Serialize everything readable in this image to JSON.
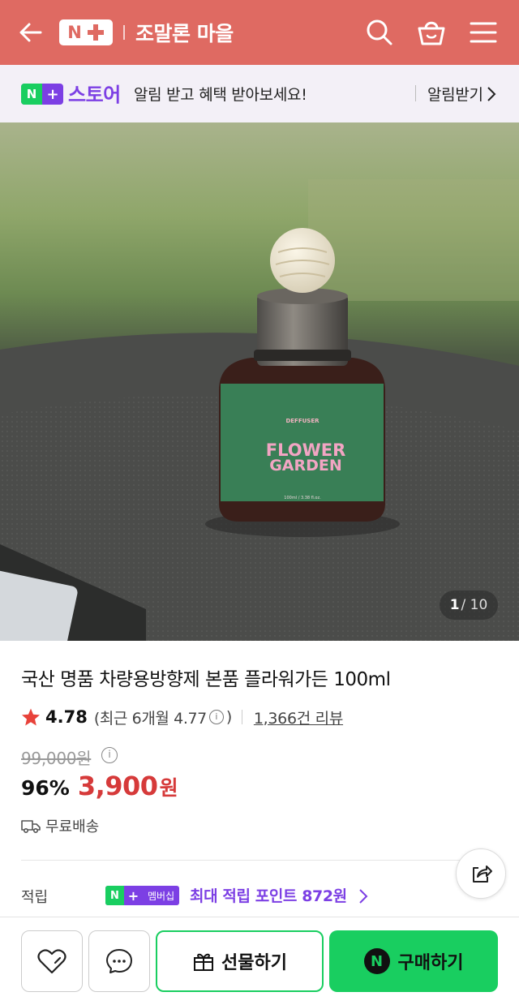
{
  "header": {
    "logo_text": "N",
    "store_name": "조말론 마을",
    "bg_color": "#df6a62"
  },
  "promo": {
    "badge_n": "N",
    "store_word": "스토어",
    "message": "알림 받고 혜택 받아보세요!",
    "alarm_label": "알림받기"
  },
  "hero": {
    "counter_current": "1",
    "counter_total": "/ 10",
    "bottle_label_top": "DEFFUSER",
    "bottle_label_line1": "FLOWER",
    "bottle_label_line2": "GARDEN",
    "bottle_label_bottom": "100ml / 3.38 fl.oz."
  },
  "product": {
    "title": "국산 명품 차량용방향제 본품 플라워가든 100ml",
    "rating": "4.78",
    "recent_rating": "(최근 6개월 4.77",
    "recent_close": ")",
    "review_count": "1,366건 리뷰",
    "original_price": "99,000원",
    "discount": "96%",
    "price": "3,900",
    "currency": "원",
    "shipping": "무료배송"
  },
  "points": {
    "label": "적립",
    "badge_n": "N",
    "badge_text": "멤버십",
    "text": "최대 적립 포인트 872원"
  },
  "bottom": {
    "gift_label": "선물하기",
    "buy_n": "N",
    "buy_label": "구매하기"
  },
  "colors": {
    "naver_green": "#19ce60",
    "plus_purple": "#7c3fe4",
    "price_red": "#d63a3a"
  }
}
